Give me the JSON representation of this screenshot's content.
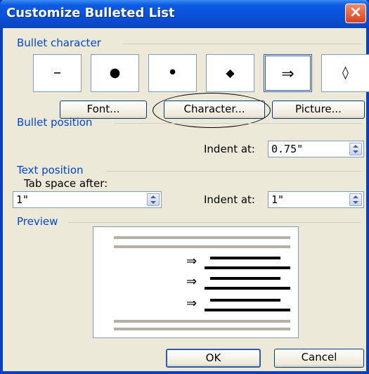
{
  "window": {
    "title": "Customize Bulleted List",
    "close_icon": "×"
  },
  "bullet_character": {
    "label": "Bullet character",
    "bullets": [
      "–",
      "●",
      "•",
      "◆",
      "⇒",
      "◊"
    ],
    "selected_index": 4,
    "font_button": "Font...",
    "character_button": "Character...",
    "picture_button": "Picture..."
  },
  "bullet_position": {
    "label": "Bullet position",
    "indent_label": "Indent at:",
    "indent_value": "0.75\""
  },
  "text_position": {
    "label": "Text position",
    "tab_label": "Tab space after:",
    "tab_value": "1\"",
    "indent_label": "Indent at:",
    "indent_value": "1\""
  },
  "preview": {
    "label": "Preview",
    "bullet_glyph": "⇒"
  },
  "buttons": {
    "ok": "OK",
    "cancel": "Cancel"
  }
}
